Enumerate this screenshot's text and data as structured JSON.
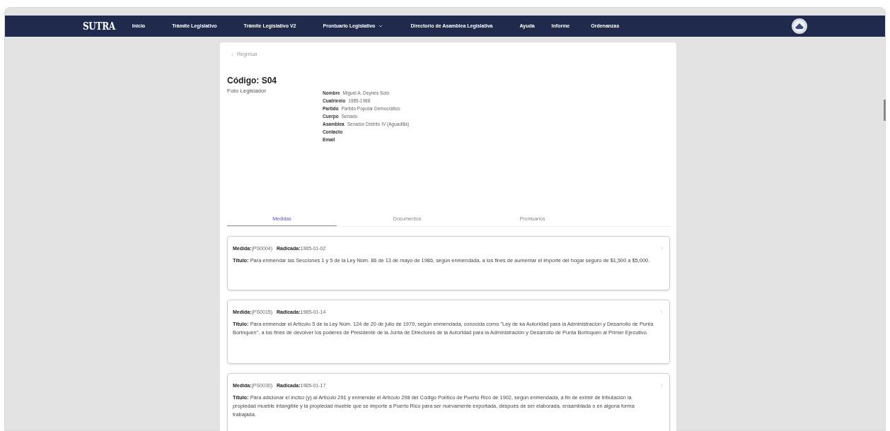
{
  "nav": {
    "brand": "SUTRA",
    "items": [
      {
        "label": "Inicio",
        "dropdown": false
      },
      {
        "label": "Trámite Legislativo",
        "dropdown": false
      },
      {
        "label": "Trámite Legislativo V2",
        "dropdown": false
      },
      {
        "label": "Prontuario Legislativo",
        "dropdown": true
      },
      {
        "label": "Directorio de Asamblea Legislativa",
        "dropdown": false
      },
      {
        "label": "Ayuda",
        "dropdown": false
      },
      {
        "label": "Informe",
        "dropdown": false
      },
      {
        "label": "Ordenanzas",
        "dropdown": false
      }
    ]
  },
  "back": "Regresar",
  "code": "Código: S04",
  "photo": "Foto Legislador",
  "details": [
    {
      "label": "Nombre",
      "value": "Miguel A. Deynes Soto"
    },
    {
      "label": "Cuatrienio",
      "value": "1985-1988"
    },
    {
      "label": "Partido",
      "value": "Partido Popular Democrático"
    },
    {
      "label": "Cuerpo",
      "value": "Senado"
    },
    {
      "label": "Asamblea",
      "value": "Senador Distrito IV (Aguadilla)"
    },
    {
      "label": "Contacto"
    },
    {
      "label": "Email"
    }
  ],
  "tabs": [
    {
      "label": "Medidas",
      "selected": true
    },
    {
      "label": "Documentos",
      "selected": false
    },
    {
      "label": "Prontuarios",
      "selected": false
    }
  ],
  "measures": [
    {
      "medida_label": "Medida:",
      "medida": "(PS0004)",
      "radicada_label": "Radicada:",
      "radicada": "1985-01-02",
      "titulo_label": "Título:",
      "titulo": "Para enmendar las Secciones 1 y 5 de la Ley Núm. 86 de 13 de mayo de 1986, según enmendada, a los fines de aumentar el importe del hogar seguro de $1,500 a $5,000."
    },
    {
      "medida_label": "Medida:",
      "medida": "(PS0015)",
      "radicada_label": "Radicada:",
      "radicada": "1985-01-14",
      "titulo_label": "Título:",
      "titulo": "Para enmendar el Artículo 5 de la Ley Núm. 124 de 20 de julio de 1979, según enmendada, conocida como \"Ley de ka Autoridad para la Administración y Desarrollo de Punta Borinquen\", a los fines de devolver los poderes de Presidente de la Junta de Directores de la Autoridad para la Administración y Desarrollo de Punta Borinquen al Primer Ejecutivo."
    },
    {
      "medida_label": "Medida:",
      "medida": "(PS0030)",
      "radicada_label": "Radicada:",
      "radicada": "1985-01-17",
      "titulo_label": "Título:",
      "titulo": "Para adicionar el inciso (y) al Artículo 291 y enmendar el Artículo 298 del Código Político de Puerto Rico de 1902, según enmendada, a fin de eximir de tributación la propiedad mueble intangible y la propiedad mueble que se importe a Puerto Rico para ser nuevamente exportada, después de ser elaborada, ensamblada o en alguna forma trabajada."
    }
  ]
}
